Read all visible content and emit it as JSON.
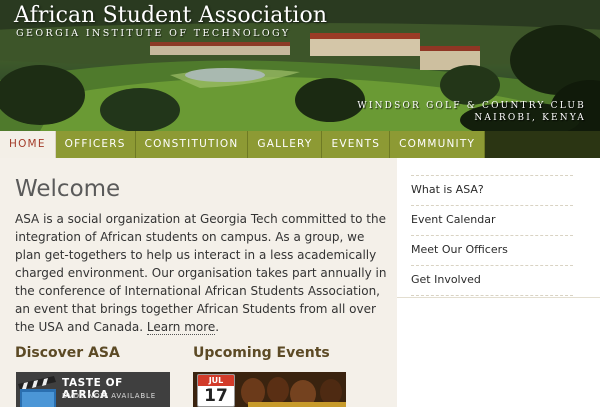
{
  "header": {
    "title": "African Student Association",
    "subtitle": "GEORGIA INSTITUTE OF TECHNOLOGY",
    "caption_line1": "WINDSOR GOLF & COUNTRY CLUB",
    "caption_line2": "NAIROBI, KENYA"
  },
  "nav": {
    "items": [
      {
        "label": "HOME",
        "active": true
      },
      {
        "label": "OFFICERS"
      },
      {
        "label": "CONSTITUTION"
      },
      {
        "label": "GALLERY"
      },
      {
        "label": "EVENTS"
      },
      {
        "label": "COMMUNITY"
      }
    ]
  },
  "main": {
    "heading": "Welcome",
    "intro_text": "ASA is a social organization at Georgia Tech committed to the integration of African students on campus. As a group, we plan get-togethers to help us interact in a less academically charged environment. Our organisation takes part annually in the conference of International African Students Association, an event that brings together African Students from all over the USA and Canada.",
    "learn_more": "Learn more",
    "learn_more_suffix": ".",
    "discover_title": "Discover ASA",
    "events_title": "Upcoming Events",
    "promo_title": "TASTE OF AFRICA",
    "promo_subtitle": "DVDS NOW AVAILABLE",
    "calendar_month": "JUL",
    "calendar_day": "17"
  },
  "sidebar": {
    "items": [
      {
        "label": "What is ASA?"
      },
      {
        "label": "Event Calendar"
      },
      {
        "label": "Meet Our Officers"
      },
      {
        "label": "Get Involved"
      }
    ]
  },
  "colors": {
    "nav_green": "#8d9a34",
    "nav_active_text": "#a33c2a",
    "main_bg": "#f4f0e9",
    "section_title": "#5c4a25"
  }
}
